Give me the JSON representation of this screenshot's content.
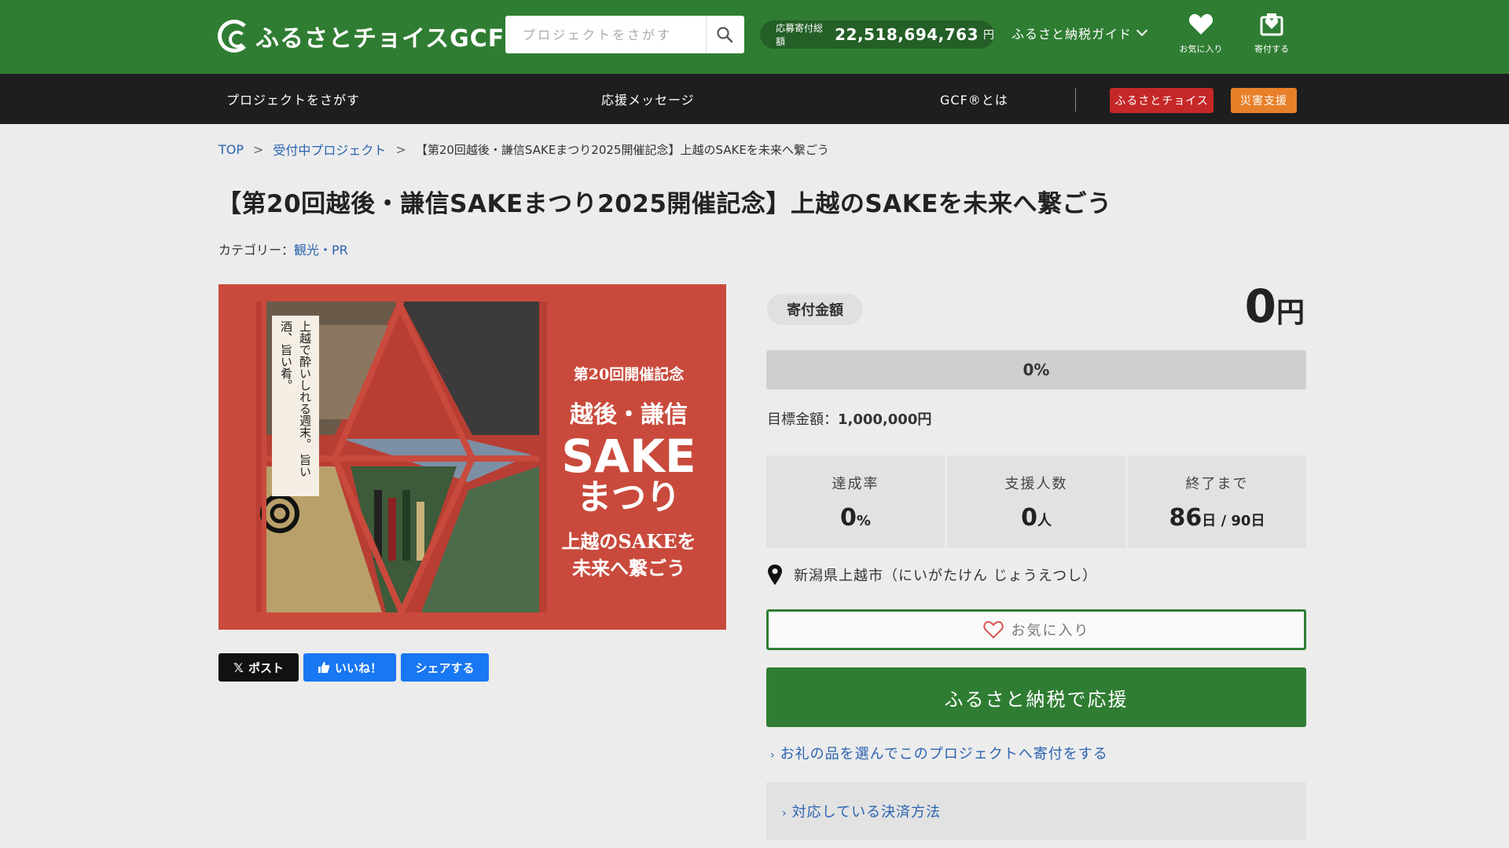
{
  "header": {
    "logo_text": "ふるさとチョイスGCF",
    "logo_mark": "®",
    "search_placeholder": "プロジェクトをさがす",
    "total_label": "応募寄付総額",
    "total_value": "22,518,694,763",
    "total_unit": "円",
    "guide_label": "ふるさと納税ガイド",
    "favorites_label": "お気に入り",
    "donate_label": "寄付する"
  },
  "nav": {
    "find_projects": "プロジェクトをさがす",
    "messages": "応援メッセージ",
    "about": "GCF®とは",
    "badge_choice": "ふるさとチョイス",
    "badge_disaster": "災害支援",
    "badge_choice_color": "#c62828",
    "badge_disaster_color": "#e8802a"
  },
  "breadcrumb": {
    "top": "TOP",
    "open_projects": "受付中プロジェクト",
    "current": "【第20回越後・謙信SAKEまつり2025開催記念】上越のSAKEを未来へ繋ごう",
    "sep1": ">",
    "sep2": ">"
  },
  "page": {
    "title": "【第20回越後・謙信SAKEまつり2025開催記念】上越のSAKEを未来へ繋ごう",
    "category_label": "カテゴリー：",
    "category_value": "観光・PR"
  },
  "hero": {
    "line1": "第20回開催記念",
    "line2": "越後・謙信",
    "line3": "SAKE",
    "line4": "まつり",
    "line5a": "上越のSAKEを",
    "line5b": "未来へ繋ごう",
    "side_text": "上越で酔いしれる週末。 旨い酒、旨い肴。"
  },
  "share": {
    "post": "ポスト",
    "like": "いいね！",
    "share": "シェアする"
  },
  "funding": {
    "amount_label": "寄付金額",
    "amount_value": "0",
    "amount_unit": "円",
    "progress_text": "0%",
    "progress_fraction": 0,
    "goal_label": "目標金額：",
    "goal_value": "1,000,000円",
    "stats": [
      {
        "label": "達成率",
        "value": "0",
        "unit": "%"
      },
      {
        "label": "支援人数",
        "value": "0",
        "unit": "人"
      },
      {
        "label": "終了まで",
        "value": "86",
        "unit": "日 / 90日"
      }
    ],
    "location": "新潟県上越市（にいがたけん じょうえつし）",
    "favorite_button": "お気に入り",
    "support_button": "ふるさと納税で応援",
    "gift_link": "お礼の品を選んでこのプロジェクトへ寄付をする",
    "payment_link": "対応している決済方法"
  },
  "colors": {
    "header_green": "#2f7d32",
    "nav_dark": "#1e1e1e",
    "hero_red": "#c94a3c",
    "link_blue": "#2a63b0"
  },
  "icons": {
    "search": "search-icon",
    "heart": "heart-icon",
    "donate": "donate-icon",
    "pin": "location-pin-icon",
    "x": "x-logo-icon",
    "thumbs": "thumbs-up-icon"
  }
}
